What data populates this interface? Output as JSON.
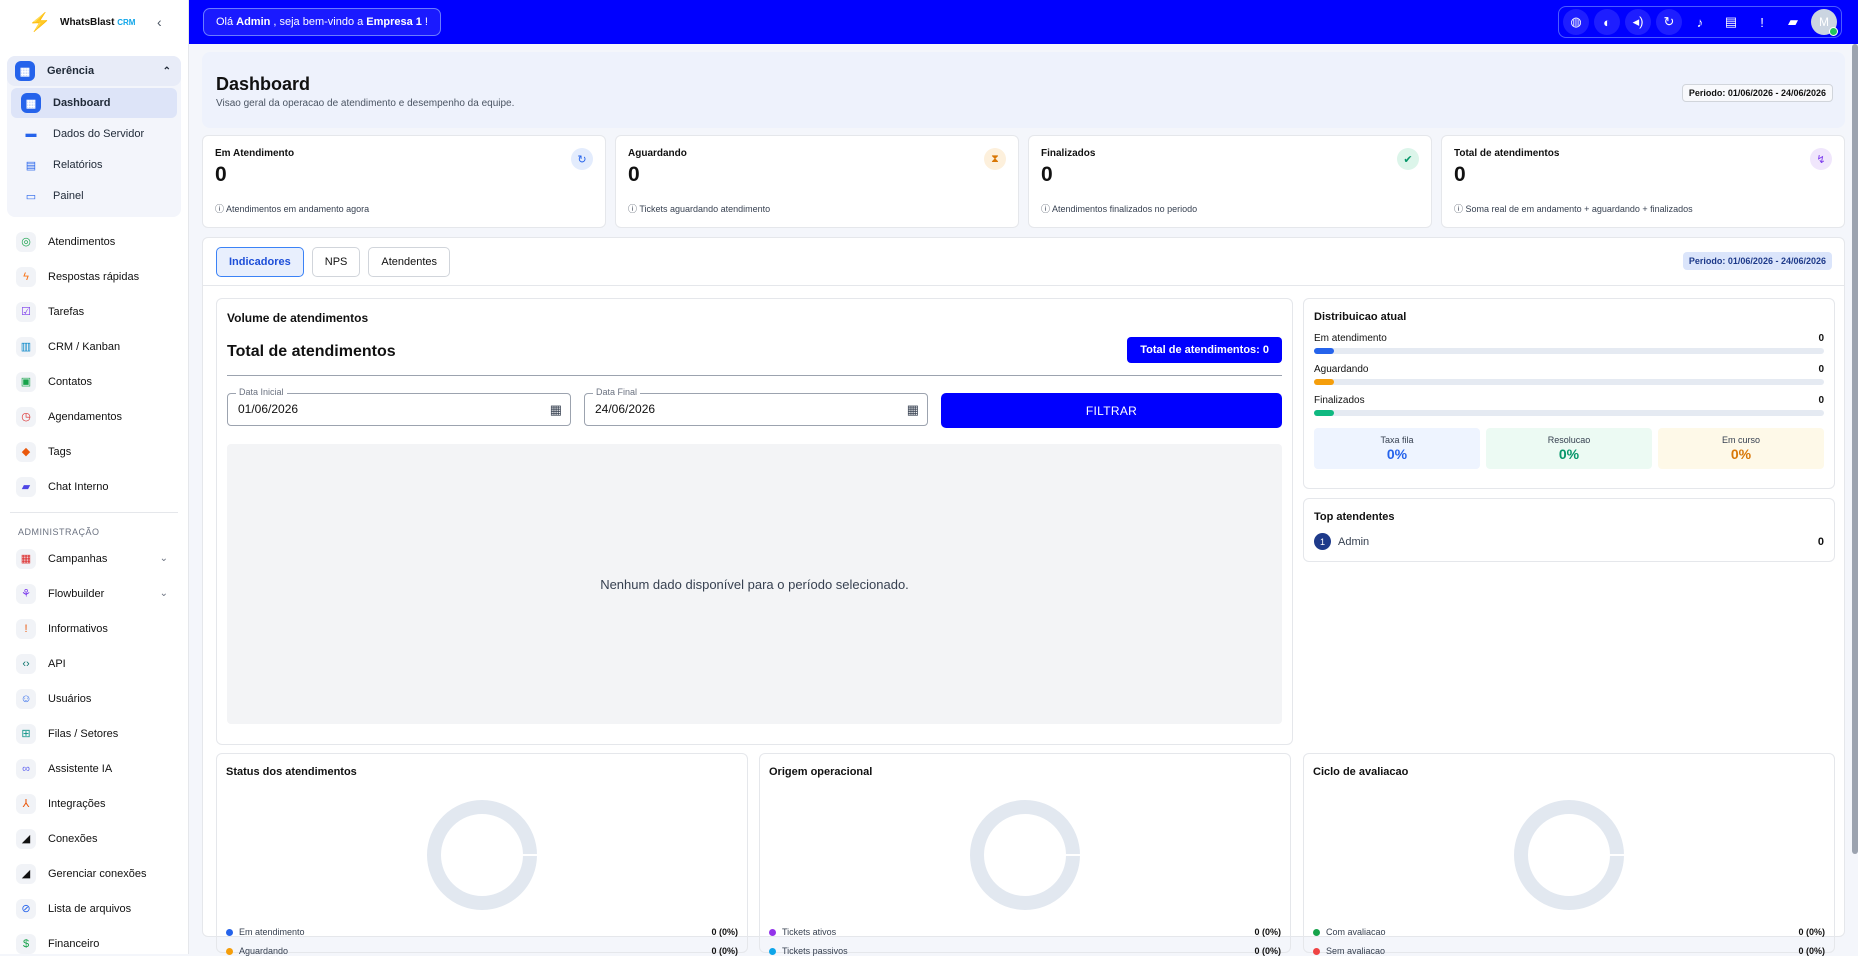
{
  "app": {
    "logo_text": "WhatsBlast",
    "logo_suffix": "CRM"
  },
  "sidebar": {
    "group": {
      "label": "Gerência",
      "items": [
        {
          "label": "Dashboard",
          "icon": "dashboard-icon",
          "active": true
        },
        {
          "label": "Dados do Servidor",
          "icon": "server-icon"
        },
        {
          "label": "Relatórios",
          "icon": "report-icon"
        },
        {
          "label": "Painel",
          "icon": "panel-icon"
        }
      ]
    },
    "items": [
      {
        "label": "Atendimentos"
      },
      {
        "label": "Respostas rápidas"
      },
      {
        "label": "Tarefas"
      },
      {
        "label": "CRM / Kanban"
      },
      {
        "label": "Contatos"
      },
      {
        "label": "Agendamentos"
      },
      {
        "label": "Tags"
      },
      {
        "label": "Chat Interno"
      }
    ],
    "section": "ADMINISTRAÇÃO",
    "admin_items": [
      {
        "label": "Campanhas"
      },
      {
        "label": "Flowbuilder"
      },
      {
        "label": "Informativos"
      },
      {
        "label": "API"
      },
      {
        "label": "Usuários"
      },
      {
        "label": "Filas / Setores"
      },
      {
        "label": "Assistente IA"
      },
      {
        "label": "Integrações"
      },
      {
        "label": "Conexões"
      },
      {
        "label": "Gerenciar conexões"
      },
      {
        "label": "Lista de arquivos"
      },
      {
        "label": "Financeiro"
      }
    ]
  },
  "topbar": {
    "greet_prefix": "Olá",
    "user": "Admin",
    "greet_mid": ", seja bem-vindo a",
    "company": "Empresa 1",
    "greet_suffix": "!",
    "avatar": "M"
  },
  "header": {
    "title": "Dashboard",
    "subtitle": "Visao geral da operacao de atendimento e desempenho da equipe.",
    "periodo": "Periodo: 01/06/2026 - 24/06/2026"
  },
  "cards": [
    {
      "label": "Em Atendimento",
      "value": "0",
      "hint": "Atendimentos em andamento agora"
    },
    {
      "label": "Aguardando",
      "value": "0",
      "hint": "Tickets aguardando atendimento"
    },
    {
      "label": "Finalizados",
      "value": "0",
      "hint": "Atendimentos finalizados no periodo"
    },
    {
      "label": "Total de atendimentos",
      "value": "0",
      "hint": "Soma real de em andamento + aguardando + finalizados"
    }
  ],
  "tabs": [
    "Indicadores",
    "NPS",
    "Atendentes"
  ],
  "periodo2": "Periodo: 01/06/2026 - 24/06/2026",
  "volume": {
    "title": "Volume de atendimentos",
    "subtitle": "Total de atendimentos",
    "total_badge": "Total de atendimentos: 0",
    "data_inicial_label": "Data Inicial",
    "data_inicial": "01/06/2026",
    "data_final_label": "Data Final",
    "data_final": "24/06/2026",
    "filter": "FILTRAR",
    "empty": "Nenhum dado disponível para o período selecionado."
  },
  "dist": {
    "title": "Distribuicao atual",
    "rows": [
      {
        "label": "Em atendimento",
        "value": "0",
        "color": "#2563eb"
      },
      {
        "label": "Aguardando",
        "value": "0",
        "color": "#f59e0b"
      },
      {
        "label": "Finalizados",
        "value": "0",
        "color": "#10b981"
      }
    ],
    "kpis": [
      {
        "label": "Taxa fila",
        "value": "0%",
        "color": "#2563eb",
        "bg": "#eef4ff"
      },
      {
        "label": "Resolucao",
        "value": "0%",
        "color": "#059669",
        "bg": "#ecfaf3"
      },
      {
        "label": "Em curso",
        "value": "0%",
        "color": "#d97706",
        "bg": "#fef9e8"
      }
    ]
  },
  "top_atendentes": {
    "title": "Top atendentes",
    "rank": "1",
    "name": "Admin",
    "value": "0"
  },
  "minis": [
    {
      "title": "Status dos atendimentos",
      "legend": [
        {
          "label": "Em atendimento",
          "value": "0 (0%)",
          "color": "#2563eb"
        },
        {
          "label": "Aguardando",
          "value": "0 (0%)",
          "color": "#f59e0b"
        }
      ]
    },
    {
      "title": "Origem operacional",
      "legend": [
        {
          "label": "Tickets ativos",
          "value": "0 (0%)",
          "color": "#9333ea"
        },
        {
          "label": "Tickets passivos",
          "value": "0 (0%)",
          "color": "#0ea5e9"
        }
      ]
    },
    {
      "title": "Ciclo de avaliacao",
      "legend": [
        {
          "label": "Com avaliacao",
          "value": "0 (0%)",
          "color": "#16a34a"
        },
        {
          "label": "Sem avaliacao",
          "value": "0 (0%)",
          "color": "#ef4444"
        }
      ]
    }
  ]
}
